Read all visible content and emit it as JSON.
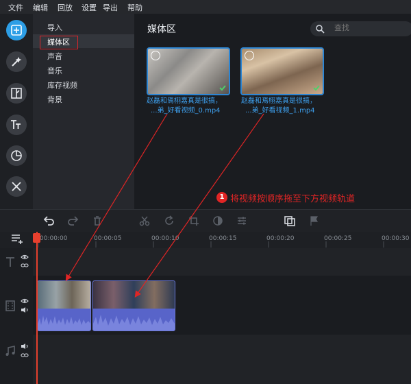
{
  "menu": [
    "文件",
    "编辑",
    "回放",
    "设置",
    "导出",
    "帮助"
  ],
  "rail": [
    "import-icon",
    "magic-wand-icon",
    "transition-icon",
    "titles-icon",
    "sticker-icon",
    "tools-icon"
  ],
  "nav": {
    "items": [
      {
        "label": "导入"
      },
      {
        "label": "媒体区"
      },
      {
        "label": "声音"
      },
      {
        "label": "音乐"
      },
      {
        "label": "库存视频"
      },
      {
        "label": "背景"
      }
    ],
    "selected_index": 1
  },
  "media": {
    "title": "媒体区",
    "search_placeholder": "查找",
    "items": [
      {
        "line1": "赵磊和焉栩嘉真是很搞，",
        "line2": "...弟_好看视频_0.mp4"
      },
      {
        "line1": "赵磊和焉栩嘉真是很搞，",
        "line2": "...弟_好看视频_1.mp4"
      }
    ]
  },
  "annotation": {
    "number": "1",
    "text": "将视频按顺序拖至下方视频轨道"
  },
  "timeline": {
    "ticks": [
      "00:00:00",
      "00:00:05",
      "00:00:10",
      "00:00:15",
      "00:00:20",
      "00:00:25",
      "00:00:30"
    ]
  },
  "colors": {
    "accent": "#2d9ee6",
    "annotation": "#e02525",
    "clip": "#4350a8",
    "playhead": "#e8402e"
  }
}
